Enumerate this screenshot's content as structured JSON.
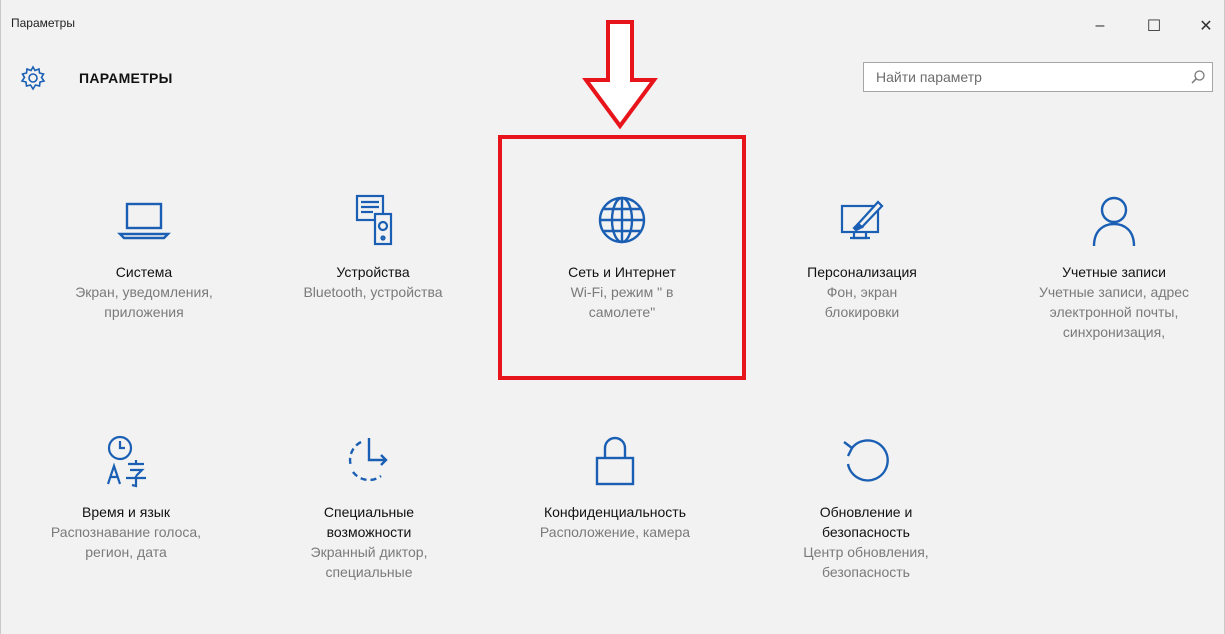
{
  "window": {
    "title": "Параметры",
    "minimize_glyph": "–",
    "maximize_glyph": "☐",
    "close_glyph": "✕"
  },
  "header": {
    "title": "ПАРАМЕТРЫ",
    "search_placeholder": "Найти параметр"
  },
  "tiles": [
    {
      "name": "Система",
      "desc1": "Экран, уведомления,",
      "desc2": "приложения",
      "desc3": "",
      "icon": "laptop-icon"
    },
    {
      "name": "Устройства",
      "desc1": "Bluetooth, устройства",
      "desc2": "",
      "desc3": "",
      "icon": "devices-icon"
    },
    {
      "name": "Сеть и Интернет",
      "desc1": "Wi-Fi, режим \" в",
      "desc2": "самолете\"",
      "desc3": "",
      "icon": "globe-icon"
    },
    {
      "name": "Персонализация",
      "desc1": "Фон, экран",
      "desc2": "блокировки",
      "desc3": "",
      "icon": "personalization-icon"
    },
    {
      "name": "Учетные записи",
      "desc1": "Учетные записи, адрес",
      "desc2": "электронной почты,",
      "desc3": "синхронизация,",
      "icon": "person-icon"
    },
    {
      "name": "Время и язык",
      "desc1": "Распознавание голоса,",
      "desc2": "регион, дата",
      "desc3": "",
      "icon": "time-language-icon"
    },
    {
      "name1": "Специальные",
      "name2": "возможности",
      "desc1": "Экранный диктор,",
      "desc2": "специальные",
      "icon": "accessibility-icon"
    },
    {
      "name": "Конфиденциальность",
      "desc1": "Расположение, камера",
      "desc2": "",
      "desc3": "",
      "icon": "lock-icon"
    },
    {
      "name1": "Обновление и",
      "name2": "безопасность",
      "desc1": "Центр обновления,",
      "desc2": "безопасность",
      "icon": "update-icon"
    }
  ],
  "colors": {
    "accent": "#1a5fb4",
    "highlight": "#e8141b",
    "background": "#f2f2f2"
  }
}
